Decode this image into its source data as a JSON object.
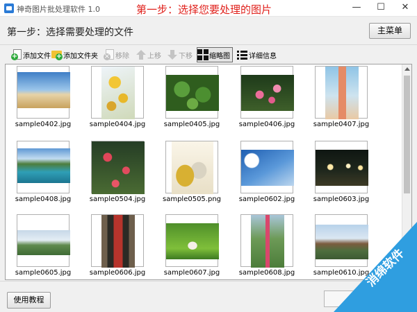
{
  "window": {
    "title": "神奇图片批处理软件 1.0",
    "step_banner": "第一步：选择您要处理的图片",
    "controls": {
      "minimize": "—",
      "maximize": "☐",
      "close": "✕"
    }
  },
  "step_bar": {
    "title": "第一步：选择需要处理的文件",
    "main_menu_label": "主菜单"
  },
  "toolbar": {
    "add_file": "添加文件",
    "add_folder": "添加文件夹",
    "remove": "移除",
    "move_up": "上移",
    "move_down": "下移",
    "thumbnail_view": "缩略图",
    "details_view": "详细信息"
  },
  "files": [
    {
      "name": "sample0402.jpg",
      "photo": "p-0402"
    },
    {
      "name": "sample0404.jpg",
      "photo": "p-0404"
    },
    {
      "name": "sample0405.jpg",
      "photo": "p-0405"
    },
    {
      "name": "sample0406.jpg",
      "photo": "p-0406"
    },
    {
      "name": "sample0407.jpg",
      "photo": "p-0407"
    },
    {
      "name": "sample0408.jpg",
      "photo": "p-0408"
    },
    {
      "name": "sample0504.jpg",
      "photo": "p-0504"
    },
    {
      "name": "sample0505.png",
      "photo": "p-0505"
    },
    {
      "name": "sample0602.jpg",
      "photo": "p-0602"
    },
    {
      "name": "sample0603.jpg",
      "photo": "p-0603"
    },
    {
      "name": "sample0605.jpg",
      "photo": "p-0605"
    },
    {
      "name": "sample0606.jpg",
      "photo": "p-0606"
    },
    {
      "name": "sample0607.jpg",
      "photo": "p-0607"
    },
    {
      "name": "sample0608.jpg",
      "photo": "p-0608"
    },
    {
      "name": "sample0610.jpg",
      "photo": "p-0610"
    }
  ],
  "bottom": {
    "tutorial_label": "使用教程"
  },
  "watermark": {
    "text": "消绵软件"
  },
  "colors": {
    "step_banner": "#e0201b",
    "watermark": "#2f9ee0"
  }
}
